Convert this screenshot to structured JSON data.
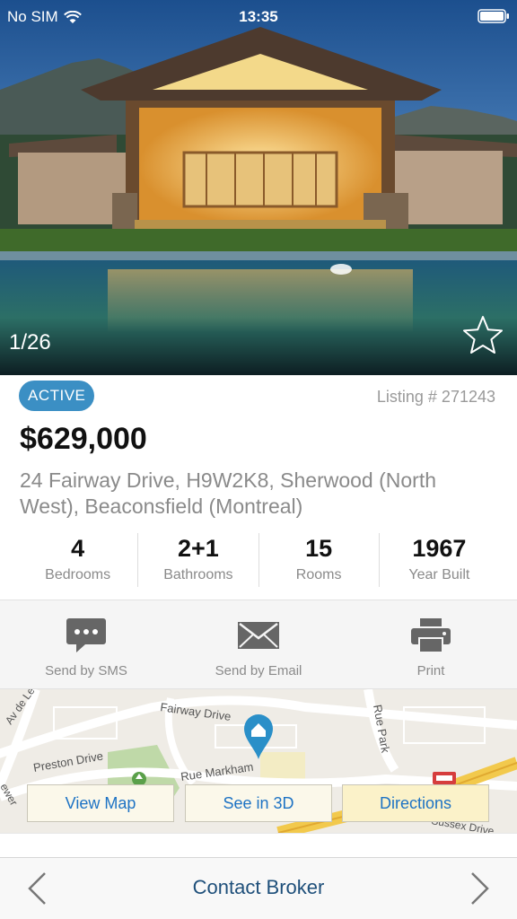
{
  "status_bar": {
    "carrier": "No SIM",
    "time": "13:35",
    "icons": [
      "wifi-icon",
      "battery-icon"
    ]
  },
  "gallery": {
    "counter": "1/26",
    "favorite_icon": "star-outline-icon"
  },
  "listing": {
    "status": "ACTIVE",
    "listing_number": "Listing # 271243",
    "price": "$629,000",
    "address": "24 Fairway Drive, H9W2K8, Sherwood (North West), Beaconsfield (Montreal)",
    "stats": [
      {
        "value": "4",
        "label": "Bedrooms"
      },
      {
        "value": "2+1",
        "label": "Bathrooms"
      },
      {
        "value": "15",
        "label": "Rooms"
      },
      {
        "value": "1967",
        "label": "Year Built"
      }
    ]
  },
  "actions": [
    {
      "label": "Send by SMS",
      "icon": "sms-bubble-icon"
    },
    {
      "label": "Send by Email",
      "icon": "envelope-icon"
    },
    {
      "label": "Print",
      "icon": "printer-icon"
    }
  ],
  "map": {
    "street_labels": [
      "Fairway Drive",
      "Rue Markham",
      "Preston Drive",
      "Rue Park",
      "Av de Lee",
      "Sussex Drive",
      "ewer"
    ],
    "buttons": {
      "view_map": "View Map",
      "see_3d": "See in 3D",
      "directions": "Directions"
    }
  },
  "bottom_bar": {
    "contact": "Contact Broker",
    "prev_icon": "chevron-left-icon",
    "next_icon": "chevron-right-icon"
  },
  "colors": {
    "badge": "#3b8fc4",
    "link": "#1e73c4",
    "pin": "#2a8fc8",
    "contact": "#1e4f7a"
  }
}
